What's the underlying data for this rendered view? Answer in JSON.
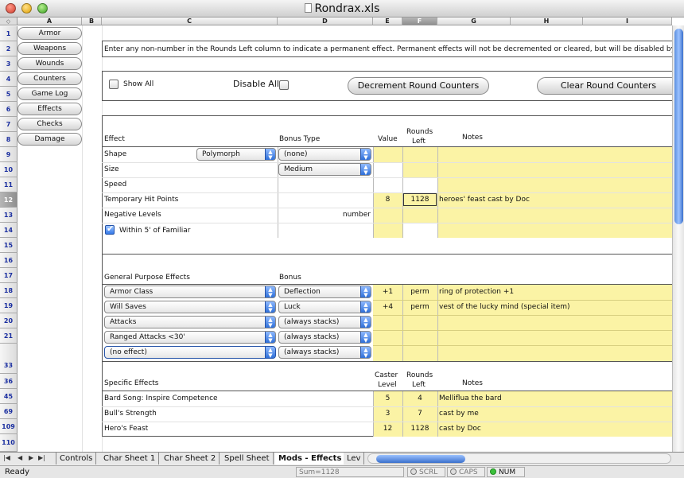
{
  "window": {
    "title": "Rondrax.xls"
  },
  "columns": [
    "A",
    "B",
    "C",
    "D",
    "E",
    "F",
    "G",
    "H",
    "I"
  ],
  "rows": [
    "1",
    "2",
    "3",
    "4",
    "5",
    "6",
    "7",
    "8",
    "9",
    "10",
    "11",
    "12",
    "13",
    "14",
    "15",
    "16",
    "17",
    "18",
    "19",
    "20",
    "21",
    "33",
    "36",
    "45",
    "69",
    "109",
    "110"
  ],
  "nav_buttons": [
    "Armor",
    "Weapons",
    "Wounds",
    "Counters",
    "Game Log",
    "Effects",
    "Checks",
    "Damage"
  ],
  "instruction": "Enter any non-number in the Rounds Left column to indicate a permanent effect.  Permanent effects will not be decremented or cleared, but will be disabled by",
  "controls": {
    "show_all": "Show All",
    "disable_all": "Disable All",
    "decrement": "Decrement Round Counters",
    "clear": "Clear Round Counters"
  },
  "effects_header": {
    "effect": "Effect",
    "bonus_type": "Bonus Type",
    "value": "Value",
    "rounds_left_1": "Rounds",
    "rounds_left_2": "Left",
    "notes": "Notes"
  },
  "effects": {
    "shape": {
      "label": "Shape",
      "select": "Polymorph",
      "bonus_type": "(none)"
    },
    "size": {
      "label": "Size",
      "bonus_type": "Medium"
    },
    "speed": {
      "label": "Speed"
    },
    "temp_hp": {
      "label": "Temporary Hit Points",
      "value": "8",
      "rounds": "1128",
      "notes": "heroes' feast cast by Doc"
    },
    "neg_levels": {
      "label": "Negative Levels",
      "bonus_type": "number"
    },
    "familiar": {
      "label": "Within 5' of Familiar",
      "checked": true
    }
  },
  "gp_header": {
    "title": "General Purpose Effects",
    "bonus": "Bonus"
  },
  "gp_effects": [
    {
      "effect": "Armor Class",
      "bonus": "Deflection",
      "value": "+1",
      "rounds": "perm",
      "notes": "ring of protection +1"
    },
    {
      "effect": "Will Saves",
      "bonus": "Luck",
      "value": "+4",
      "rounds": "perm",
      "notes": "vest of the lucky mind (special item)"
    },
    {
      "effect": "Attacks",
      "bonus": "(always stacks)",
      "value": "",
      "rounds": "",
      "notes": ""
    },
    {
      "effect": "Ranged Attacks <30'",
      "bonus": "(always stacks)",
      "value": "",
      "rounds": "",
      "notes": ""
    },
    {
      "effect": "(no effect)",
      "bonus": "(always stacks)",
      "value": "",
      "rounds": "",
      "notes": ""
    }
  ],
  "specific_header": {
    "title": "Specific Effects",
    "caster_1": "Caster",
    "caster_2": "Level",
    "rounds_1": "Rounds",
    "rounds_2": "Left",
    "notes": "Notes"
  },
  "specific_effects": [
    {
      "name": "Bard Song: Inspire Competence",
      "caster": "5",
      "rounds": "4",
      "notes": "Melliflua the bard"
    },
    {
      "name": "Bull's Strength",
      "caster": "3",
      "rounds": "7",
      "notes": "cast by me"
    },
    {
      "name": "Hero's Feast",
      "caster": "12",
      "rounds": "1128",
      "notes": "cast by Doc"
    }
  ],
  "tabs": [
    "Controls",
    "Char Sheet 1",
    "Char Sheet 2",
    "Spell Sheet",
    "Mods - Effects",
    "Lev"
  ],
  "status": {
    "ready": "Ready",
    "sum": "Sum=1128",
    "scrl": "SCRL",
    "caps": "CAPS",
    "num": "NUM"
  },
  "colors": {
    "highlight": "#fbf3a5",
    "accent": "#3479e8"
  }
}
